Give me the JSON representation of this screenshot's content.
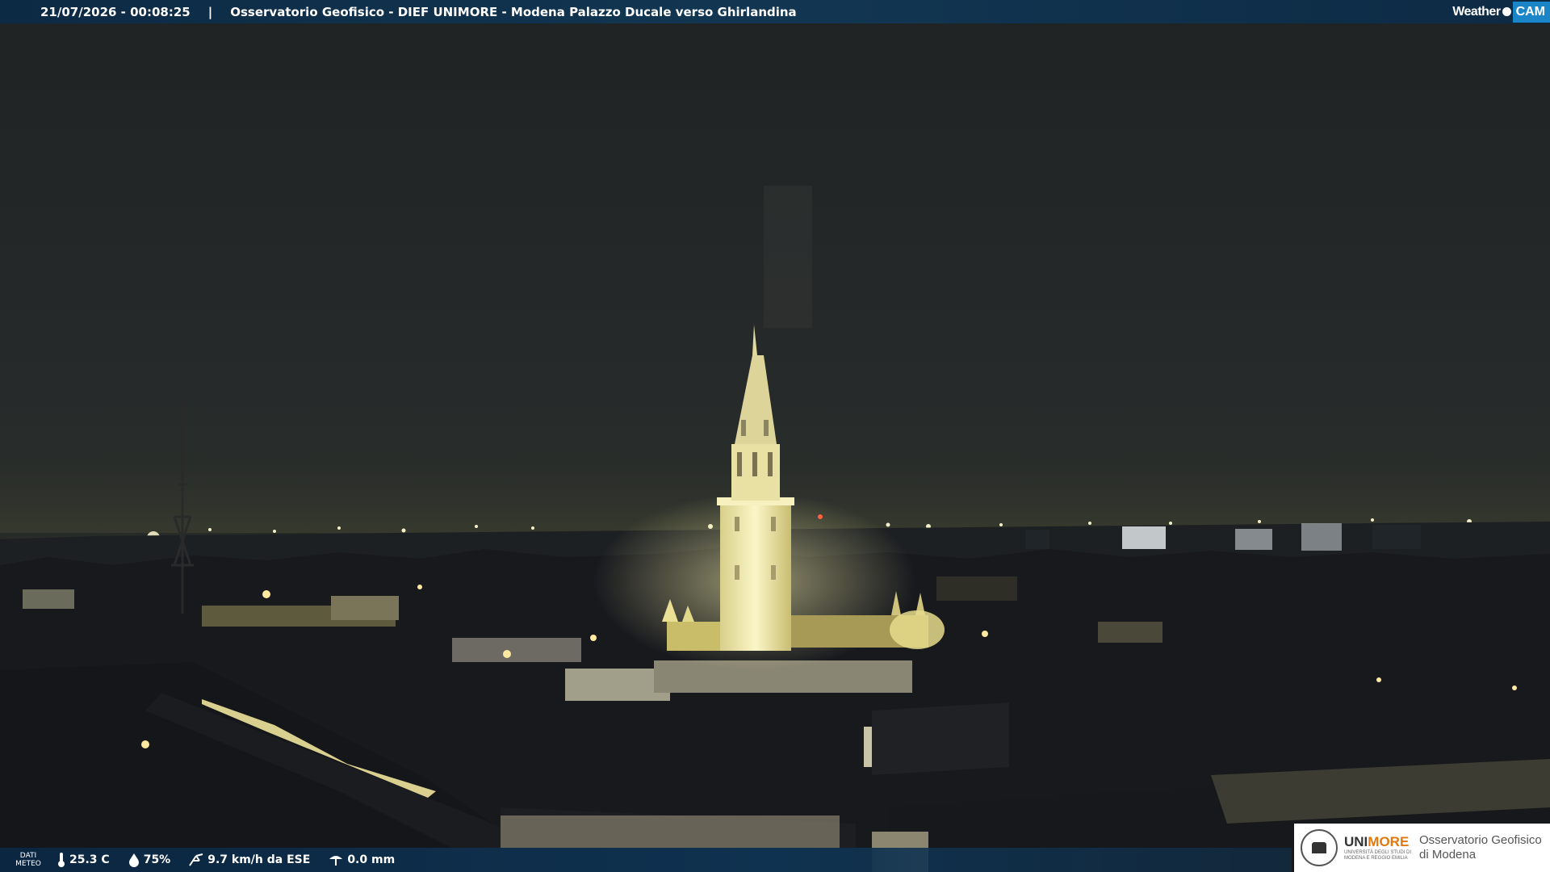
{
  "banner": {
    "timestamp": "21/07/2026 - 00:08:25",
    "separator": "|",
    "title": "Osservatorio Geofisico - DIEF UNIMORE - Modena Palazzo Ducale verso Ghirlandina"
  },
  "brand": {
    "weather": "Weather",
    "cam": "CAM"
  },
  "weather_bar": {
    "label_line1": "DATI",
    "label_line2": "METEO",
    "temperature": "25.3 C",
    "humidity": "75%",
    "wind": "9.7 km/h da ESE",
    "rain": "0.0 mm"
  },
  "logo": {
    "uni_a": "UNI",
    "uni_b": "MORE",
    "uni_sub1": "UNIVERSITÀ DEGLI STUDI DI",
    "uni_sub2": "MODENA E REGGIO EMILIA",
    "obs_line1": "Osservatorio Geofisico",
    "obs_line2": "di Modena"
  },
  "colors": {
    "banner_bg": "#123652",
    "tower_light": "#f4f0c0",
    "city_glow": "#d8c860",
    "accent_orange": "#e07a10",
    "cam_blue": "#1a86c8"
  }
}
